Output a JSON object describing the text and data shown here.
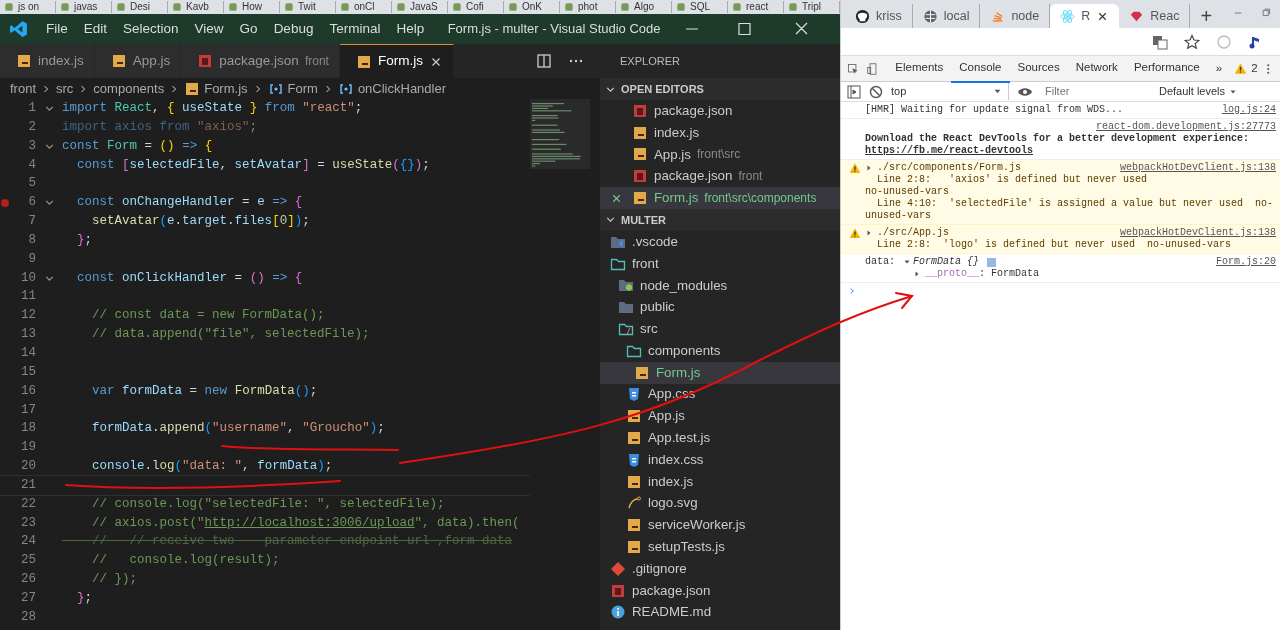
{
  "background_tabs": [
    "js on",
    "javas",
    "Desi",
    "Kavb",
    "How",
    "Twit",
    "onCl",
    "JavaS",
    "Cofi",
    "OnK",
    "phot",
    "Algo",
    "SQL",
    "react",
    "Tripl"
  ],
  "vscode": {
    "menu": [
      "File",
      "Edit",
      "Selection",
      "View",
      "Go",
      "Debug",
      "Terminal",
      "Help"
    ],
    "title": "Form.js - multer - Visual Studio Code",
    "tabs": [
      {
        "label": "index.js",
        "kind": "js",
        "selected": false
      },
      {
        "label": "App.js",
        "kind": "js",
        "selected": false
      },
      {
        "label": "package.json",
        "detail": "front",
        "kind": "npm",
        "selected": false
      },
      {
        "label": "Form.js",
        "kind": "js",
        "selected": true
      }
    ],
    "breadcrumb": [
      {
        "label": "front",
        "kind": "folder"
      },
      {
        "label": "src",
        "kind": "folder"
      },
      {
        "label": "components",
        "kind": "folder"
      },
      {
        "label": "Form.js",
        "kind": "js"
      },
      {
        "label": "Form",
        "kind": "symbol"
      },
      {
        "label": "onClickHandler",
        "kind": "symbol"
      }
    ],
    "lines": [
      {
        "n": "1",
        "kind": "code",
        "fold": true,
        "breakpoint": false,
        "text": "import React, { useState } from \"react\";"
      },
      {
        "n": "2",
        "kind": "unused",
        "fold": false,
        "breakpoint": false,
        "text": "import axios from \"axios\";"
      },
      {
        "n": "3",
        "kind": "code",
        "fold": true,
        "breakpoint": false,
        "text": "const Form = () => {"
      },
      {
        "n": "4",
        "kind": "code",
        "fold": false,
        "breakpoint": false,
        "text": "  const [selectedFile, setAvatar] = useState({});"
      },
      {
        "n": "5",
        "kind": "blank",
        "fold": false,
        "breakpoint": false
      },
      {
        "n": "6",
        "kind": "code",
        "fold": true,
        "breakpoint": true,
        "text": "  const onChangeHandler = e => {"
      },
      {
        "n": "7",
        "kind": "code",
        "fold": false,
        "breakpoint": false,
        "text": "    setAvatar(e.target.files[0]);"
      },
      {
        "n": "8",
        "kind": "code",
        "fold": false,
        "breakpoint": false,
        "text": "  };"
      },
      {
        "n": "9",
        "kind": "blank",
        "fold": false,
        "breakpoint": false
      },
      {
        "n": "10",
        "kind": "code",
        "fold": true,
        "breakpoint": false,
        "text": "  const onClickHandler = () => {"
      },
      {
        "n": "11",
        "kind": "blank",
        "fold": false,
        "breakpoint": false
      },
      {
        "n": "12",
        "kind": "comment",
        "fold": false,
        "breakpoint": false,
        "text": "    // const data = new FormData();"
      },
      {
        "n": "13",
        "kind": "comment",
        "fold": false,
        "breakpoint": false,
        "text": "    // data.append(\"file\", selectedFile);"
      },
      {
        "n": "14",
        "kind": "blank",
        "fold": false,
        "breakpoint": false
      },
      {
        "n": "15",
        "kind": "blank",
        "fold": false,
        "breakpoint": false
      },
      {
        "n": "16",
        "kind": "code",
        "fold": false,
        "breakpoint": false,
        "text": "    var formData = new FormData();"
      },
      {
        "n": "17",
        "kind": "blank",
        "fold": false,
        "breakpoint": false
      },
      {
        "n": "18",
        "kind": "code",
        "fold": false,
        "breakpoint": false,
        "text": "    formData.append(\"username\", \"Groucho\");"
      },
      {
        "n": "19",
        "kind": "blank",
        "fold": false,
        "breakpoint": false
      },
      {
        "n": "20",
        "kind": "code",
        "fold": false,
        "breakpoint": false,
        "text": "    console.log(\"data: \", formData);"
      },
      {
        "n": "21",
        "kind": "current",
        "fold": false,
        "breakpoint": false
      },
      {
        "n": "22",
        "kind": "comment",
        "fold": false,
        "breakpoint": false,
        "text": "    // console.log(\"selectedFile: \", selectedFile);"
      },
      {
        "n": "23",
        "kind": "comment",
        "fold": false,
        "breakpoint": false,
        "text": "    // axios.post(\"http://localhost:3006/upload\", data).then("
      },
      {
        "n": "24",
        "kind": "struck",
        "fold": false,
        "breakpoint": false,
        "text": "    //   // receive two    parameter endpoint url ,form data"
      },
      {
        "n": "25",
        "kind": "comment",
        "fold": false,
        "breakpoint": false,
        "text": "    //   console.log(result);"
      },
      {
        "n": "26",
        "kind": "comment",
        "fold": false,
        "breakpoint": false,
        "text": "    // });"
      },
      {
        "n": "27",
        "kind": "code",
        "fold": false,
        "breakpoint": false,
        "text": "  };"
      },
      {
        "n": "28",
        "kind": "blank",
        "fold": false,
        "breakpoint": false
      }
    ],
    "explorer": {
      "title": "EXPLORER",
      "open_editors": {
        "title": "OPEN EDITORS",
        "expanded": true,
        "items": [
          {
            "name": "package.json",
            "kind": "npm",
            "selected": false
          },
          {
            "name": "index.js",
            "kind": "js",
            "selected": false
          },
          {
            "name": "App.js",
            "detail": "front\\src",
            "kind": "js",
            "selected": false
          },
          {
            "name": "package.json",
            "detail": "front",
            "kind": "npm",
            "selected": false
          },
          {
            "name": "Form.js",
            "detail": "front\\src\\components",
            "kind": "js",
            "selected": true
          }
        ]
      },
      "workspace": {
        "title": "MULTER",
        "expanded": true,
        "tree": [
          {
            "name": ".vscode",
            "kind": "folder-vscode",
            "expanded": false,
            "selected": false
          },
          {
            "name": "front",
            "kind": "folder",
            "expanded": true,
            "selected": false,
            "children": [
              {
                "name": "node_modules",
                "kind": "folder-node",
                "expanded": false,
                "selected": false
              },
              {
                "name": "public",
                "kind": "folder",
                "expanded": false,
                "selected": false
              },
              {
                "name": "src",
                "kind": "folder-src",
                "expanded": true,
                "selected": false,
                "children": [
                  {
                    "name": "components",
                    "kind": "folder",
                    "expanded": true,
                    "selected": false,
                    "children": [
                      {
                        "name": "Form.js",
                        "kind": "js",
                        "selected": true
                      }
                    ]
                  },
                  {
                    "name": "App.css",
                    "kind": "css",
                    "selected": false
                  },
                  {
                    "name": "App.js",
                    "kind": "js",
                    "selected": false
                  },
                  {
                    "name": "App.test.js",
                    "kind": "js",
                    "selected": false
                  },
                  {
                    "name": "index.css",
                    "kind": "css",
                    "selected": false
                  },
                  {
                    "name": "index.js",
                    "kind": "js",
                    "selected": false
                  },
                  {
                    "name": "logo.svg",
                    "kind": "svg",
                    "selected": false
                  },
                  {
                    "name": "serviceWorker.js",
                    "kind": "js",
                    "selected": false
                  },
                  {
                    "name": "setupTests.js",
                    "kind": "js",
                    "selected": false
                  }
                ]
              }
            ]
          },
          {
            "name": ".gitignore",
            "kind": "git",
            "selected": false
          },
          {
            "name": "package.json",
            "kind": "npm",
            "selected": false
          },
          {
            "name": "README.md",
            "kind": "info",
            "selected": false
          }
        ]
      }
    }
  },
  "browser": {
    "tabs": [
      {
        "label": "kriss",
        "kind": "github",
        "selected": false
      },
      {
        "label": "local",
        "kind": "globe",
        "selected": false
      },
      {
        "label": "node",
        "kind": "stack",
        "selected": false
      },
      {
        "label": "R",
        "kind": "react",
        "selected": true
      },
      {
        "label": "Reac",
        "kind": "gem",
        "selected": false
      }
    ],
    "new_tab": "+",
    "devtools": {
      "tabs": [
        {
          "label": "Elements",
          "selected": false
        },
        {
          "label": "Console",
          "selected": true
        },
        {
          "label": "Sources",
          "selected": false
        },
        {
          "label": "Network",
          "selected": false
        },
        {
          "label": "Performance",
          "selected": false
        }
      ],
      "more_tabs": "»",
      "warnings": "2",
      "context": "top",
      "filter": {
        "placeholder": "Filter"
      },
      "levels": "Default levels",
      "messages": [
        {
          "kind": "log",
          "text": "[HMR] Waiting for update signal from WDS...",
          "source": "log.js:24"
        },
        {
          "kind": "banner",
          "source": "react-dom.development.js:27773",
          "text": "Download the React DevTools for a better development experience: ",
          "link": "https://fb.me/react-devtools"
        },
        {
          "kind": "warning",
          "expanded": false,
          "title": "./src/components/Form.js",
          "source": "webpackHotDevClient.js:138",
          "lines": [
            "  Line 2:8:   'axios' is defined but never used                     no-unused-vars",
            "  Line 4:10:  'selectedFile' is assigned a value but never used  no-unused-vars"
          ]
        },
        {
          "kind": "warning",
          "expanded": false,
          "title": "./src/App.js",
          "source": "webpackHotDevClient.js:138",
          "lines": [
            "  Line 2:8:  'logo' is defined but never used  no-unused-vars"
          ]
        },
        {
          "kind": "object",
          "label": "data:",
          "value": "FormData {}",
          "expanded": true,
          "source": "Form.js:20",
          "children": [
            {
              "key": "__proto__",
              "value": ": FormData",
              "expanded": false
            }
          ]
        }
      ]
    }
  }
}
